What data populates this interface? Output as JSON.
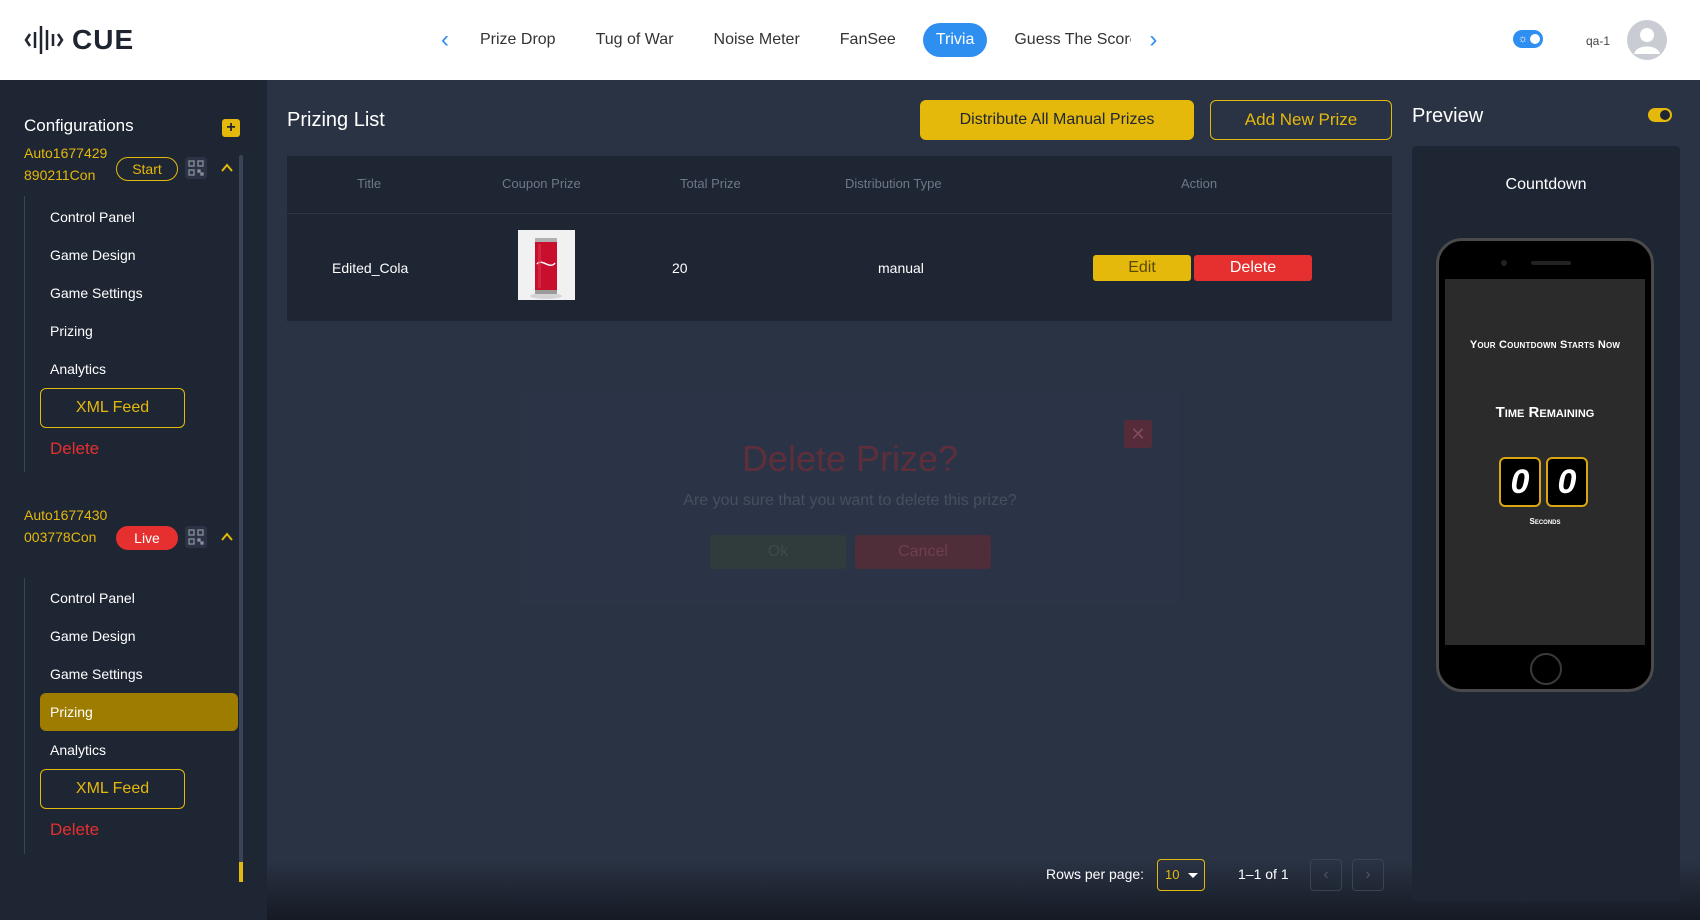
{
  "brand": {
    "name": "CUE"
  },
  "nav": {
    "tabs": [
      {
        "label": "Prize Drop"
      },
      {
        "label": "Tug of War"
      },
      {
        "label": "Noise Meter"
      },
      {
        "label": "FanSee"
      },
      {
        "label": "Trivia",
        "active": true
      },
      {
        "label": "Guess The Score"
      }
    ]
  },
  "user": {
    "name": "qa-1"
  },
  "sidebar": {
    "title": "Configurations",
    "configs": [
      {
        "name": "Auto1677429890211Con",
        "status": "Start",
        "items": [
          "Control Panel",
          "Game Design",
          "Game Settings",
          "Prizing",
          "Analytics"
        ],
        "xml_label": "XML Feed",
        "delete_label": "Delete"
      },
      {
        "name": "Auto1677430003778Con",
        "status": "Live",
        "items": [
          "Control Panel",
          "Game Design",
          "Game Settings",
          "Prizing",
          "Analytics"
        ],
        "active_item": "Prizing",
        "xml_label": "XML Feed",
        "delete_label": "Delete"
      }
    ]
  },
  "main": {
    "title": "Prizing List",
    "distribute_label": "Distribute All Manual Prizes",
    "add_label": "Add New Prize",
    "table": {
      "columns": [
        "Title",
        "Coupon Prize",
        "Total Prize",
        "Distribution Type",
        "Action"
      ],
      "rows": [
        {
          "title": "Edited_Cola",
          "total": "20",
          "distribution": "manual",
          "edit": "Edit",
          "delete": "Delete"
        }
      ]
    },
    "pagination": {
      "rows_label": "Rows per page:",
      "rows_value": "10",
      "range": "1–1 of 1"
    }
  },
  "modal": {
    "title": "Delete Prize?",
    "message": "Are you sure that you want to delete this prize?",
    "ok": "Ok",
    "cancel": "Cancel"
  },
  "preview": {
    "title": "Preview",
    "label": "Countdown",
    "screen": {
      "heading": "Your Countdown Starts Now",
      "time_label": "Time Remaining",
      "digits": [
        "0",
        "0"
      ],
      "unit": "Seconds"
    }
  },
  "colors": {
    "accent": "#e5b90b",
    "danger": "#e63030",
    "tab_active": "#2f8ff0",
    "panel": "#1e2533",
    "background": "#2a3344"
  }
}
